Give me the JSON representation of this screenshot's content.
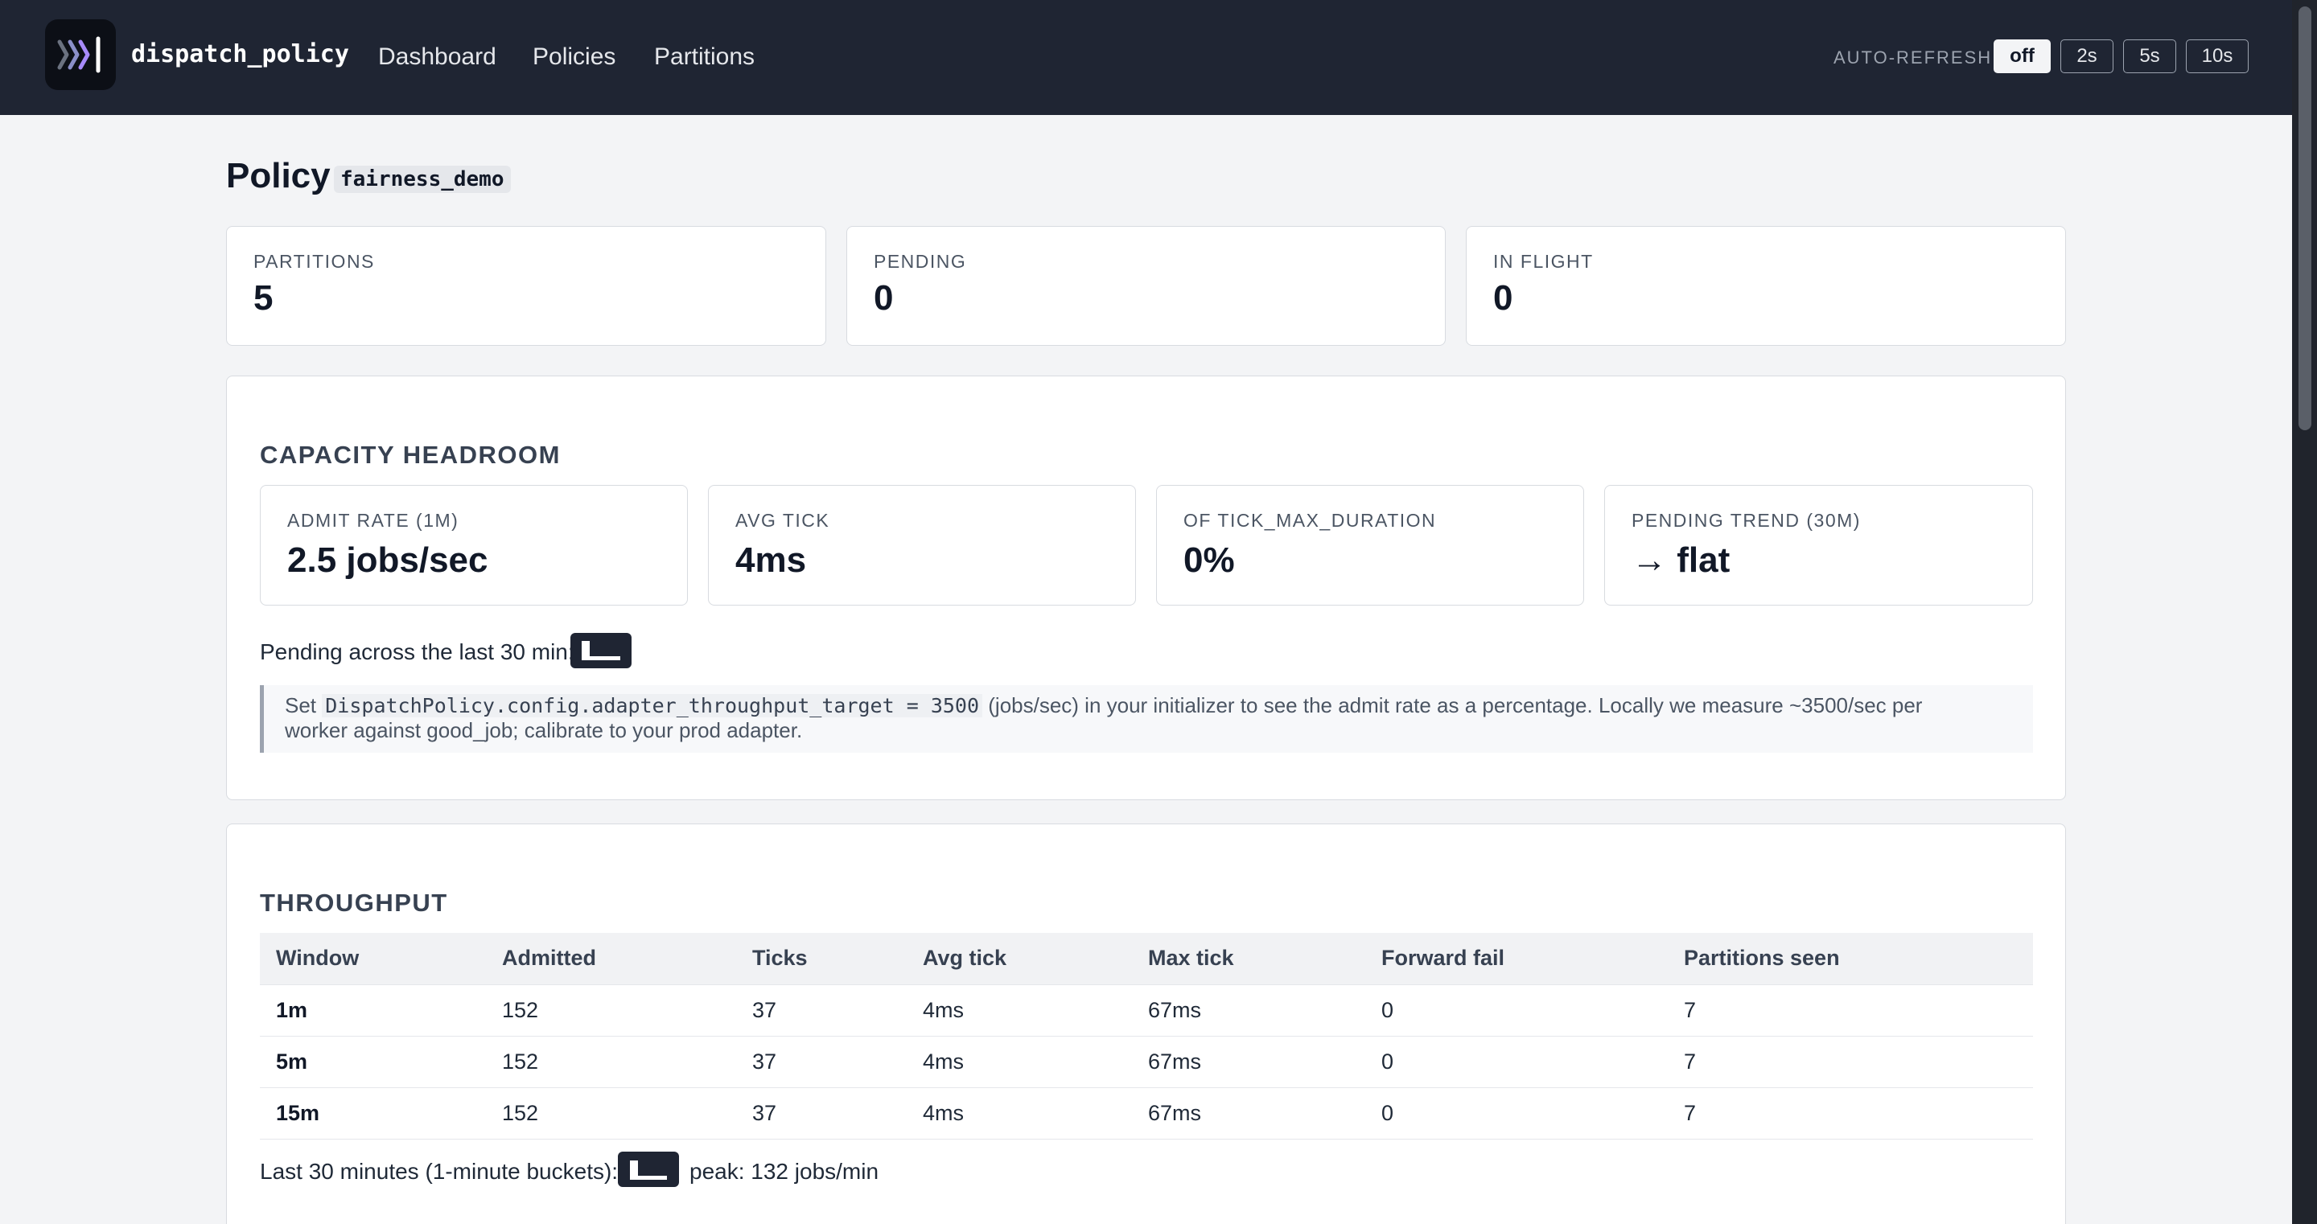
{
  "app": {
    "brand": "dispatch_policy",
    "nav": [
      "Dashboard",
      "Policies",
      "Partitions"
    ],
    "auto_refresh": {
      "label": "AUTO-REFRESH",
      "options": [
        "off",
        "2s",
        "5s",
        "10s"
      ],
      "selected": "off"
    }
  },
  "page": {
    "title": "Policy",
    "policy_name": "fairness_demo"
  },
  "stats": [
    {
      "label": "PARTITIONS",
      "value": "5"
    },
    {
      "label": "PENDING",
      "value": "0"
    },
    {
      "label": "IN FLIGHT",
      "value": "0"
    }
  ],
  "capacity": {
    "title": "CAPACITY HEADROOM",
    "metrics": [
      {
        "label": "ADMIT RATE (1M)",
        "value": "2.5 jobs/sec"
      },
      {
        "label": "AVG TICK",
        "value": "4ms"
      },
      {
        "label": "OF TICK_MAX_DURATION",
        "value": "0%"
      },
      {
        "label": "PENDING TREND (30M)",
        "value": "→ flat"
      }
    ],
    "pending_label": "Pending across the last 30 min:",
    "note": {
      "prefix": "Set ",
      "code": "DispatchPolicy.config.adapter_throughput_target = 3500",
      "line1_suffix": " (jobs/sec) in your initializer to see the admit rate as a percentage. Locally we measure ~3500/sec per",
      "line2": "worker against good_job; calibrate to your prod adapter."
    }
  },
  "throughput": {
    "title": "THROUGHPUT",
    "columns": [
      "Window",
      "Admitted",
      "Ticks",
      "Avg tick",
      "Max tick",
      "Forward fail",
      "Partitions seen"
    ],
    "rows": [
      [
        "1m",
        "152",
        "37",
        "4ms",
        "67ms",
        "0",
        "7"
      ],
      [
        "5m",
        "152",
        "37",
        "4ms",
        "67ms",
        "0",
        "7"
      ],
      [
        "15m",
        "152",
        "37",
        "4ms",
        "67ms",
        "0",
        "7"
      ]
    ],
    "footer_label": "Last 30 minutes (1-minute buckets):",
    "peak": "peak: 132 jobs/min"
  }
}
